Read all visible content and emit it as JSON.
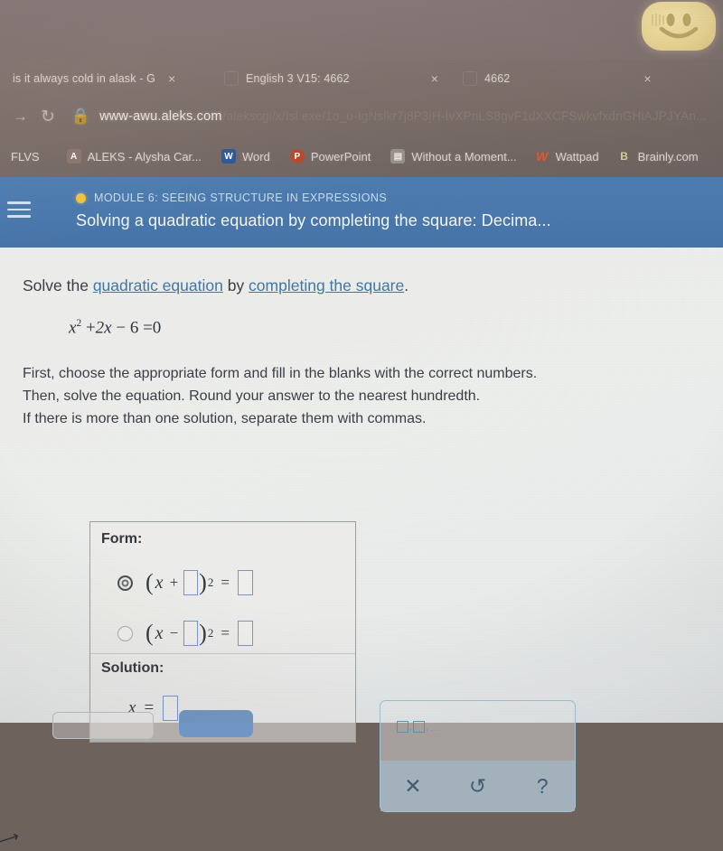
{
  "browser": {
    "tabs": [
      {
        "title": "is it always cold in alask - G",
        "close": "×",
        "has_favicon": false
      },
      {
        "title": "English 3 V15: 4662",
        "close": "×",
        "has_favicon": true
      },
      {
        "title": "4662",
        "close": "×",
        "has_favicon": true
      }
    ],
    "toolbar": {
      "forward_icon": "→",
      "reload_icon": "↻",
      "lock_icon": "🔒",
      "url_host": "www-awu.aleks.com",
      "url_path": "/alekscgi/x/Isl.exe/1o_u-IgNslkr7j8P3jH-IvXPnLS8gvF1dXXCFSwkvfxdnGHiAJPJYAn..."
    },
    "bookmarks": [
      {
        "label": "FLVS",
        "icon_text": "",
        "icon_color": "transparent"
      },
      {
        "label": "ALEKS - Alysha Car...",
        "icon_text": "A",
        "icon_color": "#9c7f78"
      },
      {
        "label": "Word",
        "icon_text": "W",
        "icon_color": "#2b5797"
      },
      {
        "label": "PowerPoint",
        "icon_text": "P",
        "icon_color": "#b7472a"
      },
      {
        "label": "Without a Moment...",
        "icon_text": "▤",
        "icon_color": "#8d8d8d"
      },
      {
        "label": "Wattpad",
        "icon_text": "W",
        "icon_color": "#e8562a"
      },
      {
        "label": "Brainly.com",
        "icon_text": "B",
        "icon_color": "#c9bd7a"
      }
    ]
  },
  "overlay": {
    "smiley_label": "smiley-face-sticker"
  },
  "aleks": {
    "header": {
      "module_label": "MODULE 6: SEEING STRUCTURE IN EXPRESSIONS",
      "lesson_title": "Solving a quadratic equation by completing the square: Decima...",
      "menu_icon": "hamburger-menu",
      "dot_color": "#f0c33c",
      "bar_color": "#4a78ad"
    },
    "expand_tab_icon": "chevron-down",
    "problem": {
      "instruction_prefix": "Solve the ",
      "link1": "quadratic equation",
      "instruction_mid": " by ",
      "link2": "completing the square",
      "instruction_suffix": ".",
      "equation": {
        "term1_var": "x",
        "term1_exp": "2",
        "op1": "+",
        "term2": "2x",
        "op2": "−",
        "term3": "6",
        "equals": "=",
        "rhs": "0",
        "full_text": "x² + 2x − 6 = 0"
      },
      "directions_line1": "First, choose the appropriate form and fill in the blanks with the correct numbers.",
      "directions_line2": "Then, solve the equation. Round your answer to the nearest hundredth.",
      "directions_line3": "If there is more than one solution, separate them with commas."
    },
    "form_panel": {
      "title": "Form:",
      "options": [
        {
          "selected": true,
          "open_paren": "(",
          "var": "x",
          "sign": "+",
          "exponent": "2",
          "equals": "=",
          "close_paren": ")",
          "blank_inner": "",
          "blank_rhs": ""
        },
        {
          "selected": false,
          "open_paren": "(",
          "var": "x",
          "sign": "−",
          "exponent": "2",
          "equals": "=",
          "close_paren": ")",
          "blank_inner": "",
          "blank_rhs": ""
        }
      ]
    },
    "solution_panel": {
      "title": "Solution:",
      "var_label": "x",
      "equals": "=",
      "answer_value": ""
    },
    "math_palette": {
      "multi_answer_label": "□,□,...",
      "buttons": [
        {
          "name": "clear",
          "glyph": "✕"
        },
        {
          "name": "undo",
          "glyph": "↺"
        },
        {
          "name": "help",
          "glyph": "?"
        }
      ]
    },
    "footer": {
      "secondary_button_label": "",
      "primary_button_label": ""
    }
  },
  "colors": {
    "header_blue": "#4a78ad",
    "link_blue": "#3f78a8",
    "blank_border": "#7b95c9",
    "palette_border": "#9ec2d8",
    "accent_yellow": "#f0c33c",
    "page_bg": "#e9e9e4"
  }
}
